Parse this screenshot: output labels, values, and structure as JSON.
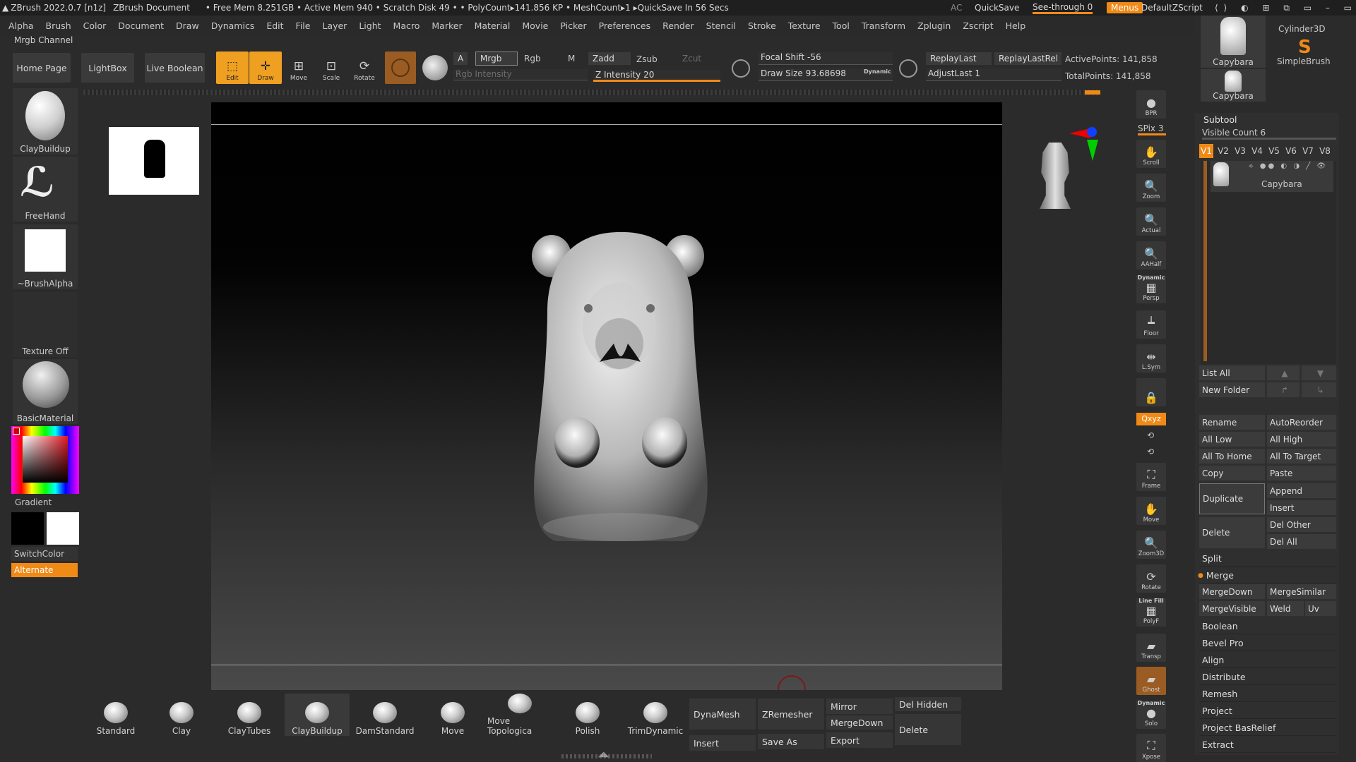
{
  "titlebar": {
    "app": "ZBrush 2022.0.7 [n1z]",
    "doc": "ZBrush Document",
    "stats": "• Free Mem 8.251GB • Active Mem 940 • Scratch Disk 49 • • PolyCount▸141.856 KP • MeshCount▸1 ▸QuickSave In 56 Secs",
    "ac": "AC",
    "quicksave": "QuickSave",
    "seethrough": "See-through 0",
    "menus": "Menus",
    "script": "DefaultZScript"
  },
  "menu": [
    "Alpha",
    "Brush",
    "Color",
    "Document",
    "Draw",
    "Dynamics",
    "Edit",
    "File",
    "Layer",
    "Light",
    "Macro",
    "Marker",
    "Material",
    "Movie",
    "Picker",
    "Preferences",
    "Render",
    "Stencil",
    "Stroke",
    "Texture",
    "Tool",
    "Transform",
    "Zplugin",
    "Zscript",
    "Help"
  ],
  "channel": "Mrgb Channel",
  "shelf": {
    "home": "Home Page",
    "lightbox": "LightBox",
    "liveboolean": "Live Boolean",
    "edit": "Edit",
    "draw": "Draw",
    "move": "Move",
    "scale": "Scale",
    "rotate": "Rotate",
    "a": "A",
    "mrgb": "Mrgb",
    "rgb": "Rgb",
    "m": "M",
    "rgb_intensity": "Rgb Intensity",
    "zadd": "Zadd",
    "zsub": "Zsub",
    "zcut": "Zcut",
    "z_intensity": "Z Intensity 20",
    "focal": "Focal Shift -56",
    "drawsize": "Draw Size 93.68698",
    "dynamic": "Dynamic",
    "replaylast": "ReplayLast",
    "replaylastrel": "ReplayLastRel",
    "adjustlast": "AdjustLast 1",
    "activepoints": "ActivePoints: 141,858",
    "totalpoints": "TotalPoints: 141,858"
  },
  "left": {
    "claybuildup": "ClayBuildup",
    "freehand": "FreeHand",
    "brushalpha": "~BrushAlpha",
    "texture": "Texture Off",
    "material": "BasicMaterial",
    "gradient": "Gradient",
    "switchcolor": "SwitchColor",
    "alternate": "Alternate"
  },
  "right_tools": {
    "bpr": "BPR",
    "spix": "SPix 3",
    "scroll": "Scroll",
    "zoom": "Zoom",
    "actual": "Actual",
    "aahalf": "AAHalf",
    "dynamic": "Dynamic",
    "persp": "Persp",
    "floor": "Floor",
    "lsym": "L.Sym",
    "xyz": "Qxyz",
    "frame": "Frame",
    "move": "Move",
    "zoom3d": "Zoom3D",
    "rotate": "Rotate",
    "linefill": "Line Fill",
    "polyf": "PolyF",
    "transp": "Transp",
    "ghost": "Ghost",
    "solo_dyn": "Dynamic",
    "solo": "Solo",
    "xpose": "Xpose"
  },
  "tool_thumbs": {
    "capy1": "Capybara",
    "cyl": "Cylinder3D",
    "simple": "SimpleBrush",
    "capy2": "Capybara"
  },
  "subtool": {
    "title": "Subtool",
    "visible": "Visible Count 6",
    "versions": [
      "V1",
      "V2",
      "V3",
      "V4",
      "V5",
      "V6",
      "V7",
      "V8"
    ],
    "item": "Capybara",
    "listall": "List All",
    "newfolder": "New Folder",
    "rename": "Rename",
    "autoreorder": "AutoReorder",
    "alllow": "All Low",
    "allhigh": "All High",
    "alltohome": "All To Home",
    "alltotarget": "All To Target",
    "copy": "Copy",
    "paste": "Paste",
    "duplicate": "Duplicate",
    "append": "Append",
    "insert": "Insert",
    "delete": "Delete",
    "delother": "Del Other",
    "delall": "Del All",
    "split": "Split",
    "merge": "Merge",
    "mergedown": "MergeDown",
    "mergesimilar": "MergeSimilar",
    "mergevisible": "MergeVisible",
    "weld": "Weld",
    "uv": "Uv",
    "boolean": "Boolean",
    "bevelpro": "Bevel Pro",
    "align": "Align",
    "distribute": "Distribute",
    "remesh": "Remesh",
    "project": "Project",
    "projectbasrelief": "Project BasRelief",
    "extract": "Extract"
  },
  "brushes": [
    "Standard",
    "Clay",
    "ClayTubes",
    "ClayBuildup",
    "DamStandard",
    "Move",
    "Move Topologica",
    "Polish",
    "TrimDynamic"
  ],
  "bottom": {
    "dynamesh": "DynaMesh",
    "zremesher": "ZRemesher",
    "mirror": "Mirror",
    "delhidden": "Del Hidden",
    "mergedown": "MergeDown",
    "delete": "Delete",
    "insert": "Insert",
    "saveas": "Save As",
    "export": "Export"
  },
  "colors": {
    "accent": "#f08a17",
    "panel": "#2f2f2f",
    "bg": "#2b2b2b"
  }
}
